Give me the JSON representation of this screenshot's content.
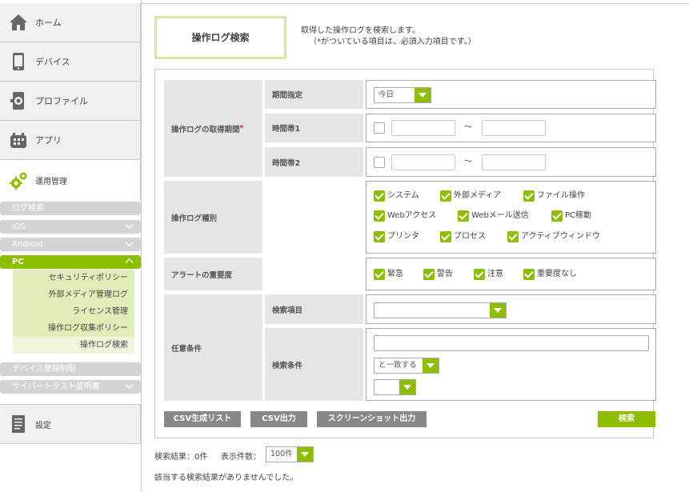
{
  "sidebar": {
    "home": "ホーム",
    "device": "デバイス",
    "profile": "プロファイル",
    "app": "アプリ",
    "ops": "運用管理",
    "subcats": {
      "log_search": "ログ検索",
      "ios": "iOS",
      "android": "Android",
      "pc": "PC",
      "device_reg": "デバイス登録制御",
      "cybertrust": "サイバートラスト証明書"
    },
    "pc_items": [
      "セキュリティポリシー",
      "外部メディア管理ログ",
      "ライセンス管理",
      "操作ログ収集ポリシー",
      "操作ログ検索"
    ],
    "settings": "設定"
  },
  "header": {
    "title": "操作ログ検索",
    "desc1": "取得した操作ログを検索します。",
    "desc2": "（*がついている項目は、必須入力項目です。）"
  },
  "form": {
    "period_label": "操作ログの取得期間",
    "required_mark": "*",
    "period_spec_label": "期間指定",
    "period_select": "今日",
    "time1_label": "時間帯1",
    "time2_label": "時間帯2",
    "tilde": "～",
    "type_label": "操作ログ種別",
    "types": [
      "システム",
      "外部メディア",
      "ファイル操作",
      "Webアクセス",
      "Webメール送信",
      "PC稼動",
      "プリンタ",
      "プロセス",
      "アクティブウィンドウ"
    ],
    "alert_label": "アラートの重要度",
    "alerts": [
      "緊急",
      "警告",
      "注意",
      "重要度なし"
    ],
    "optional_label": "任意条件",
    "search_item_label": "検索項目",
    "search_cond_label": "検索条件",
    "match_select": "と一致する"
  },
  "buttons": {
    "csv_list": "CSV生成リスト",
    "csv_out": "CSV出力",
    "screenshot": "スクリーンショット出力",
    "search": "検索"
  },
  "results": {
    "count": "検索結果：0件",
    "per_page_label": "表示件数：",
    "per_page": "100件",
    "none": "該当する検索結果がありませんでした。"
  },
  "colors": {
    "accent": "#8dbf00",
    "title_border": "#d6e9a0"
  }
}
